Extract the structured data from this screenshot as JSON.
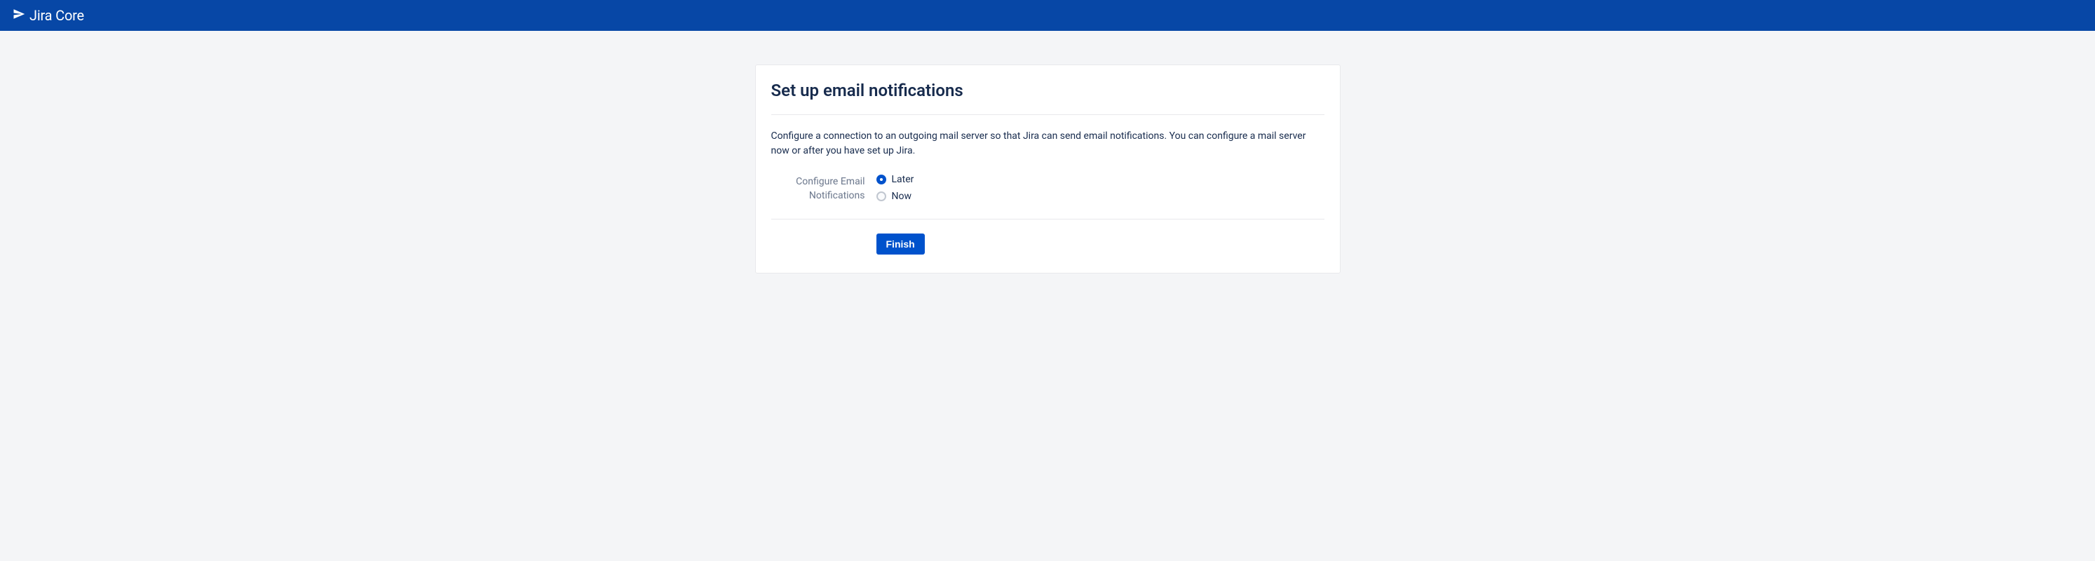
{
  "header": {
    "product_name": "Jira Core"
  },
  "card": {
    "title": "Set up email notifications",
    "description": "Configure a connection to an outgoing mail server so that Jira can send email notifications. You can configure a mail server now or after you have set up Jira.",
    "field_label": "Configure Email Notifications",
    "options": {
      "later": "Later",
      "now": "Now"
    },
    "selected_option": "later",
    "submit_label": "Finish"
  }
}
